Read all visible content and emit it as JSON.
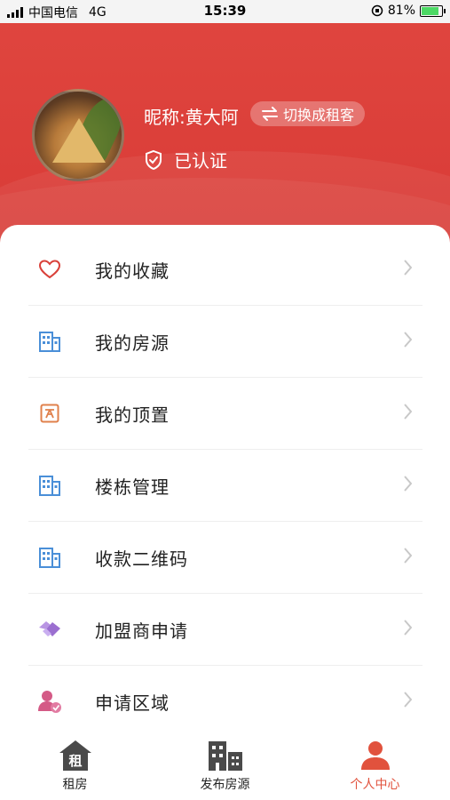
{
  "status_bar": {
    "carrier": "中国电信",
    "network": "4G",
    "time": "15:39",
    "battery": "81%",
    "battery_level": 0.81
  },
  "profile": {
    "nickname": "昵称:黄大阿",
    "switch_label": "切换成租客",
    "verified_label": "已认证",
    "avatar": "zongzi-photo"
  },
  "menu": [
    {
      "label": "我的收藏",
      "icon": "heart-icon",
      "color": "#d9413a"
    },
    {
      "label": "我的房源",
      "icon": "building-icon",
      "color": "#4a8fd8"
    },
    {
      "label": "我的顶置",
      "icon": "pin-box-icon",
      "color": "#e0804b"
    },
    {
      "label": "楼栋管理",
      "icon": "building-icon",
      "color": "#4a8fd8"
    },
    {
      "label": "收款二维码",
      "icon": "building-icon",
      "color": "#4a8fd8"
    },
    {
      "label": "加盟商申请",
      "icon": "handshake-icon",
      "color": "#9b6fd0"
    },
    {
      "label": "申请区域",
      "icon": "user-check-icon",
      "color": "#d45a86"
    }
  ],
  "tabs": [
    {
      "label": "租房",
      "icon": "house-rent-icon",
      "active": false
    },
    {
      "label": "发布房源",
      "icon": "buildings-icon",
      "active": false
    },
    {
      "label": "个人中心",
      "icon": "person-icon",
      "active": true
    }
  ],
  "colors": {
    "header": "#d83a36",
    "accent": "#e1523d",
    "chevron": "#c8c8c8"
  }
}
